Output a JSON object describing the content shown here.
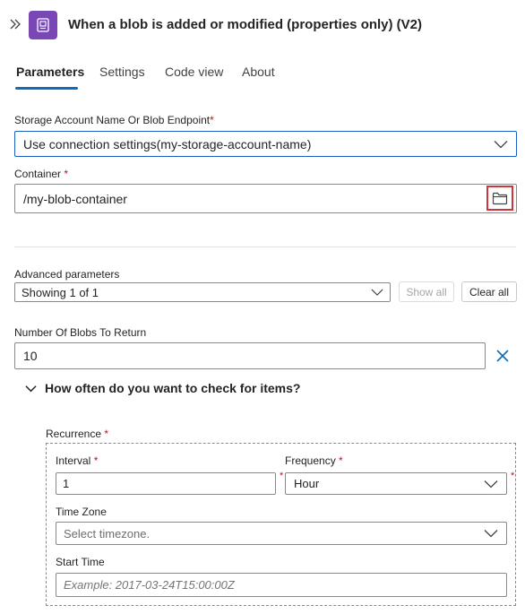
{
  "header": {
    "title": "When a blob is added or modified (properties only) (V2)"
  },
  "tabs": [
    {
      "label": "Parameters"
    },
    {
      "label": "Settings"
    },
    {
      "label": "Code view"
    },
    {
      "label": "About"
    }
  ],
  "storage": {
    "label": "Storage Account Name Or Blob Endpoint",
    "required": "*",
    "value": "Use connection settings(my-storage-account-name)"
  },
  "container": {
    "label": "Container",
    "required": "*",
    "value": "/my-blob-container"
  },
  "advanced": {
    "label": "Advanced parameters",
    "value": "Showing 1 of 1",
    "show_all": "Show all",
    "clear_all": "Clear all"
  },
  "blobs": {
    "label": "Number Of Blobs To Return",
    "value": "10"
  },
  "section": {
    "title": "How often do you want to check for items?"
  },
  "recurrence": {
    "label": "Recurrence",
    "required": "*",
    "interval_label": "Interval",
    "interval_value": "1",
    "frequency_label": "Frequency",
    "frequency_value": "Hour",
    "timezone_label": "Time Zone",
    "timezone_placeholder": "Select timezone.",
    "starttime_label": "Start Time",
    "starttime_placeholder": "Example: 2017-03-24T15:00:00Z"
  },
  "colors": {
    "accent": "#0f6cbd",
    "app_icon": "#7a48b5",
    "required": "#c50f1f",
    "highlight": "#d13438"
  },
  "icons": [
    "chevron-double-right-icon",
    "blob-trigger-icon",
    "chevron-down-icon",
    "folder-icon",
    "close-icon"
  ]
}
